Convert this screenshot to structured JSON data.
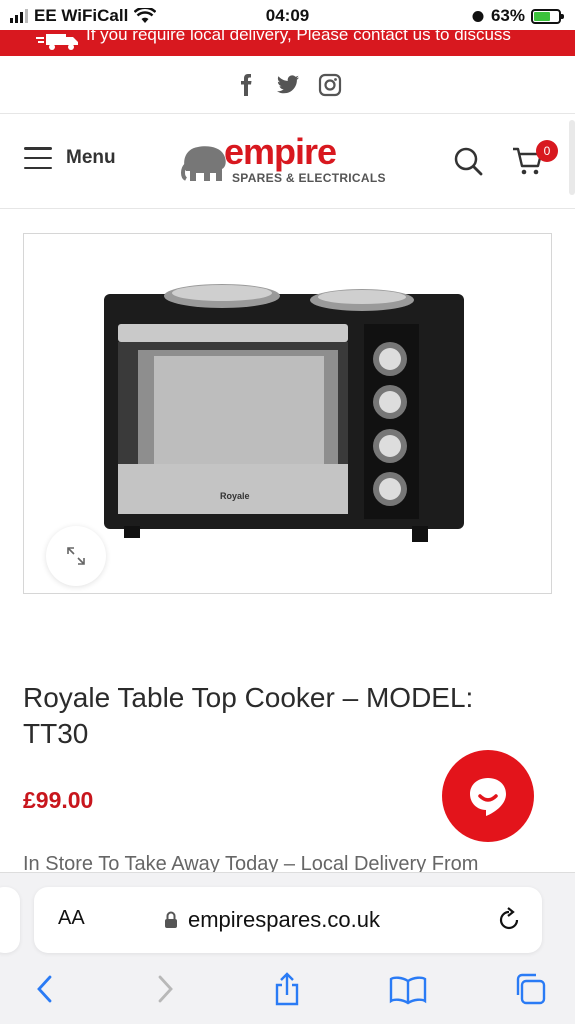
{
  "status_bar": {
    "carrier": "EE WiFiCall",
    "time": "04:09",
    "battery": "63%",
    "battery_level": 0.63
  },
  "promo": {
    "text": "If you require local delivery, Please contact us to discuss"
  },
  "social": {
    "icons": [
      "facebook-icon",
      "twitter-icon",
      "instagram-icon"
    ]
  },
  "header": {
    "menu_label": "Menu",
    "logo_word": "empire",
    "logo_sub": "SPARES & ELECTRICALS",
    "cart_count": "0"
  },
  "product": {
    "image_brand": "Royale",
    "title": "Royale Table Top Cooker – MODEL: TT30",
    "price": "£99.00",
    "stock_text": "In Store To Take Away Today – Local Delivery From"
  },
  "browser": {
    "aa_label": "AA",
    "url": "empirespares.co.uk"
  },
  "colors": {
    "brand_red": "#d8181f",
    "price_red": "#c8161d"
  }
}
